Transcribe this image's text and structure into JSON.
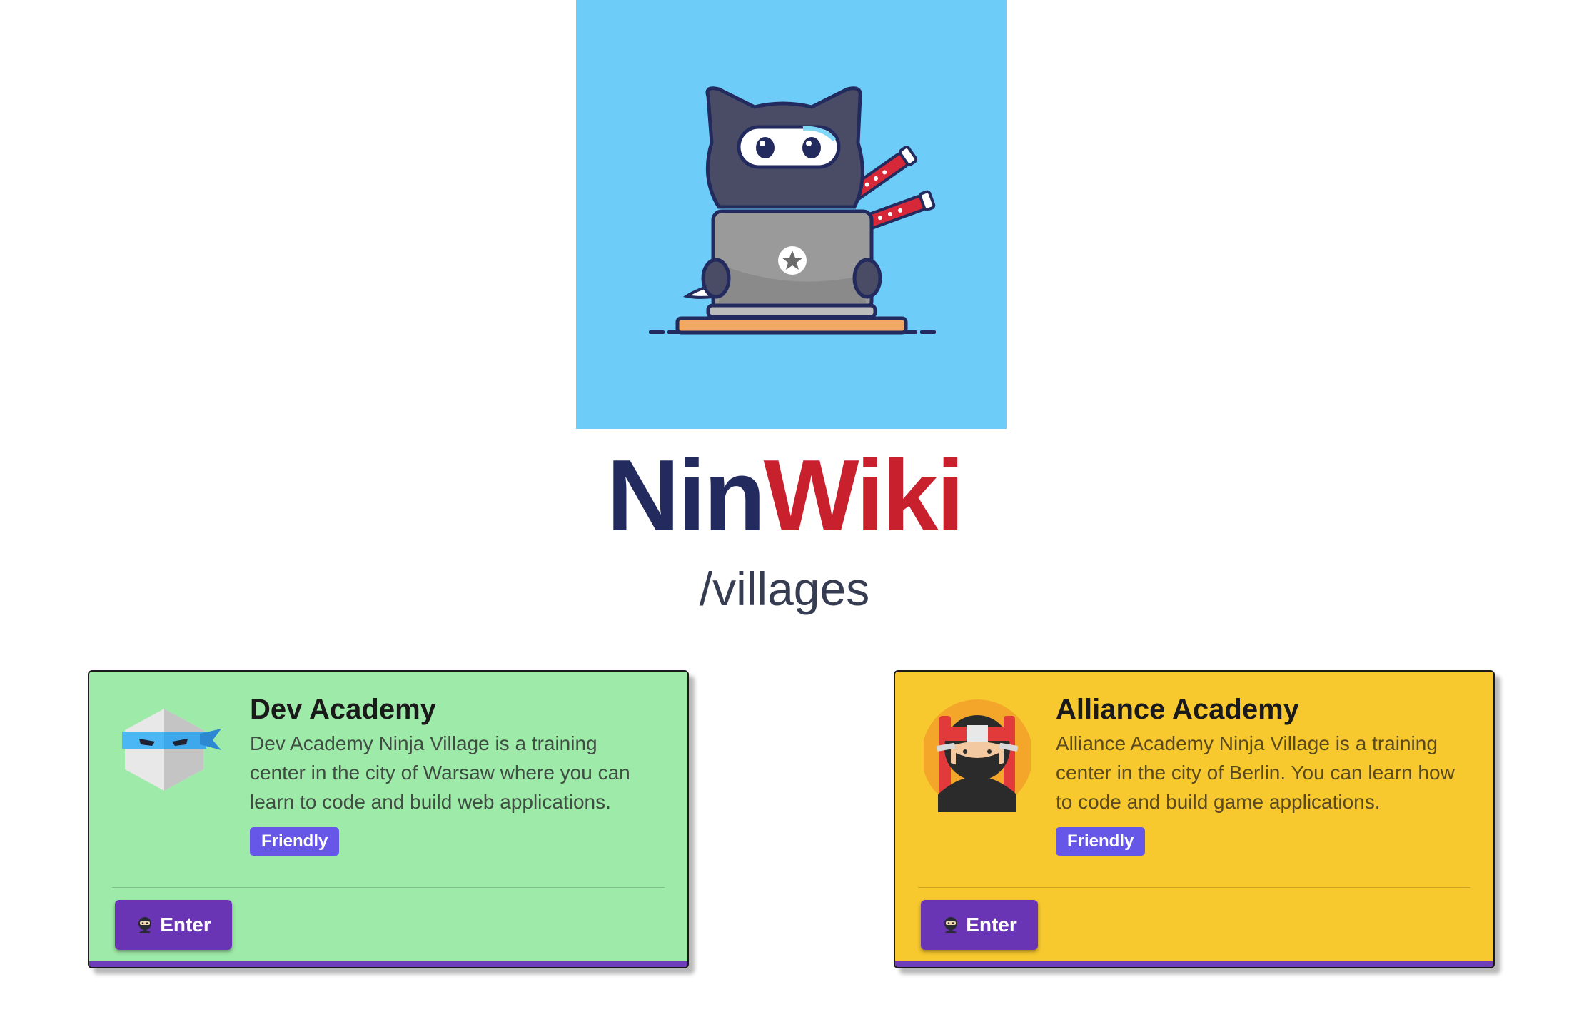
{
  "hero": {
    "image_icon": "ninja-cat-laptop-icon",
    "background_color": "#6ecdf8"
  },
  "brand": {
    "part1": "Nin",
    "part2": "Wiki",
    "part1_color": "#232a5e",
    "part2_color": "#c8202c"
  },
  "subtitle": "/villages",
  "villages": [
    {
      "name": "Dev Academy",
      "description": "Dev Academy Ninja Village is a training center in the city of Warsaw where you can learn to code and build web applications.",
      "badge": "Friendly",
      "button_label": "Enter",
      "button_icon": "ninja-emoji-icon",
      "avatar_icon": "white-ninja-icon",
      "card_color": "#9eeba9"
    },
    {
      "name": "Alliance Academy",
      "description": "Alliance Academy Ninja Village is a training center in the city of Berlin. You can learn how to code and build game applications.",
      "badge": "Friendly",
      "button_label": "Enter",
      "button_icon": "ninja-emoji-icon",
      "avatar_icon": "red-headband-ninja-icon",
      "card_color": "#f7c92f"
    }
  ]
}
